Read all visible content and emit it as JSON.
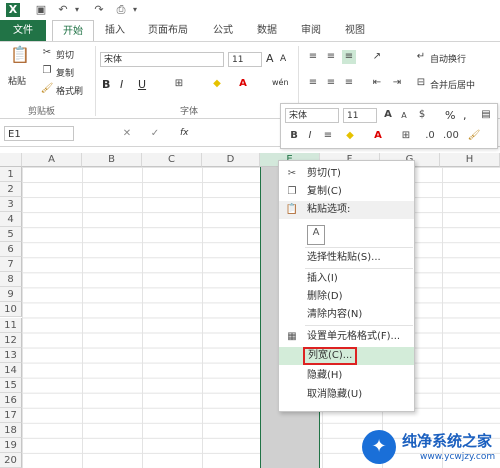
{
  "quick_access": {
    "icons": [
      "excel-icon",
      "save-icon",
      "undo-icon",
      "redo-icon",
      "quick-print-icon"
    ]
  },
  "tabs": [
    "文件",
    "开始",
    "插入",
    "页面布局",
    "公式",
    "数据",
    "审阅",
    "视图"
  ],
  "ribbon": {
    "clipboard": {
      "paste": "粘贴",
      "cut": "剪切",
      "copy": "复制",
      "format_painter": "格式刷",
      "group": "剪贴板"
    },
    "font": {
      "name": "宋体",
      "size": "11",
      "bold": "B",
      "italic": "I",
      "underline": "U",
      "group": "字体",
      "grow": "A",
      "shrink": "A",
      "phonetic": "wén"
    },
    "alignment": {
      "wrap": "自动换行",
      "merge": "合并后居中"
    }
  },
  "formula_bar": {
    "name_box": "E1",
    "fx": "fx"
  },
  "columns": [
    "A",
    "B",
    "C",
    "D",
    "E",
    "F",
    "G",
    "H"
  ],
  "rows": [
    "1",
    "2",
    "3",
    "4",
    "5",
    "6",
    "7",
    "8",
    "9",
    "10",
    "11",
    "12",
    "13",
    "14",
    "15",
    "16",
    "17",
    "18",
    "19",
    "20"
  ],
  "mini_toolbar": {
    "font": "宋体",
    "size": "11",
    "percent": "%",
    "comma": ","
  },
  "context_menu": {
    "items": [
      {
        "label": "剪切(T)",
        "icon": "scissors-icon"
      },
      {
        "label": "复制(C)",
        "icon": "copy-icon"
      },
      {
        "label": "粘贴选项:",
        "icon": "paste-icon"
      },
      {
        "label": "",
        "icon": "paste-option-icon"
      },
      {
        "label": "选择性粘贴(S)...",
        "icon": ""
      },
      {
        "label": "插入(I)",
        "icon": ""
      },
      {
        "label": "删除(D)",
        "icon": ""
      },
      {
        "label": "清除内容(N)",
        "icon": ""
      },
      {
        "label": "设置单元格格式(F)...",
        "icon": "format-cells-icon"
      },
      {
        "label": "列宽(C)...",
        "icon": ""
      },
      {
        "label": "隐藏(H)",
        "icon": ""
      },
      {
        "label": "取消隐藏(U)",
        "icon": ""
      }
    ]
  },
  "watermark": {
    "title": "纯净系统之家",
    "url": "www.ycwjzy.com"
  }
}
